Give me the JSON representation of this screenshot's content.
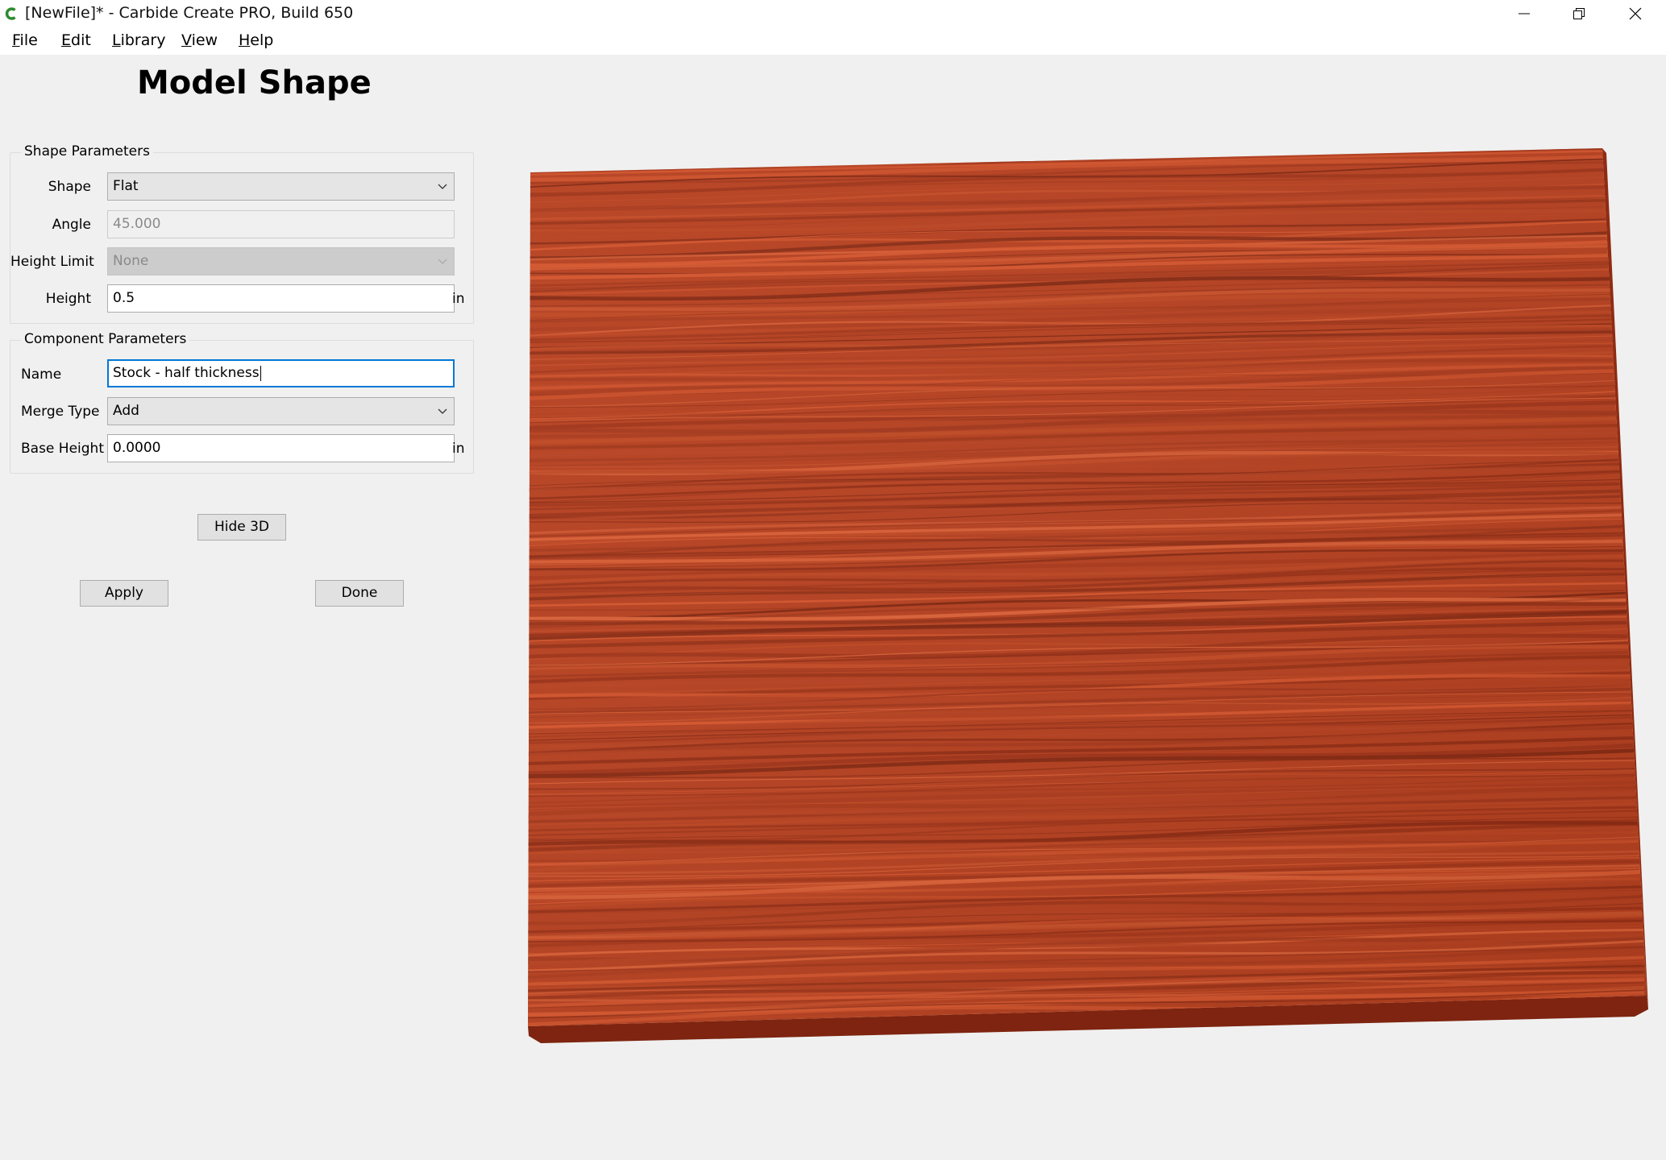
{
  "window": {
    "title": "[NewFile]* - Carbide Create PRO, Build 650",
    "controls": [
      "minimize-icon",
      "restore-icon",
      "close-icon"
    ]
  },
  "menu": [
    "File",
    "Edit",
    "Library",
    "View",
    "Help"
  ],
  "page_title": "Model Shape",
  "shape_params": {
    "group_title": "Shape Parameters",
    "shape": {
      "label": "Shape",
      "value": "Flat"
    },
    "angle": {
      "label": "Angle",
      "value": "45.000",
      "disabled": true
    },
    "height_limit": {
      "label": "Height Limit",
      "value": "None",
      "disabled": true
    },
    "height": {
      "label": "Height",
      "value": "0.5",
      "unit": "in"
    }
  },
  "component_params": {
    "group_title": "Component Parameters",
    "name": {
      "label": "Name",
      "value": "Stock - half thickness"
    },
    "merge_type": {
      "label": "Merge Type",
      "value": "Add"
    },
    "base_height": {
      "label": "Base Height",
      "value": "0.0000",
      "unit": "in"
    }
  },
  "buttons": {
    "hide3d": "Hide 3D",
    "apply": "Apply",
    "done": "Done"
  },
  "colors": {
    "accent": "#0078d7",
    "wood_base": "#b6401f",
    "wood_dark": "#8c2a12",
    "wood_light": "#d9582f",
    "window_bg": "#f0f0f0"
  }
}
